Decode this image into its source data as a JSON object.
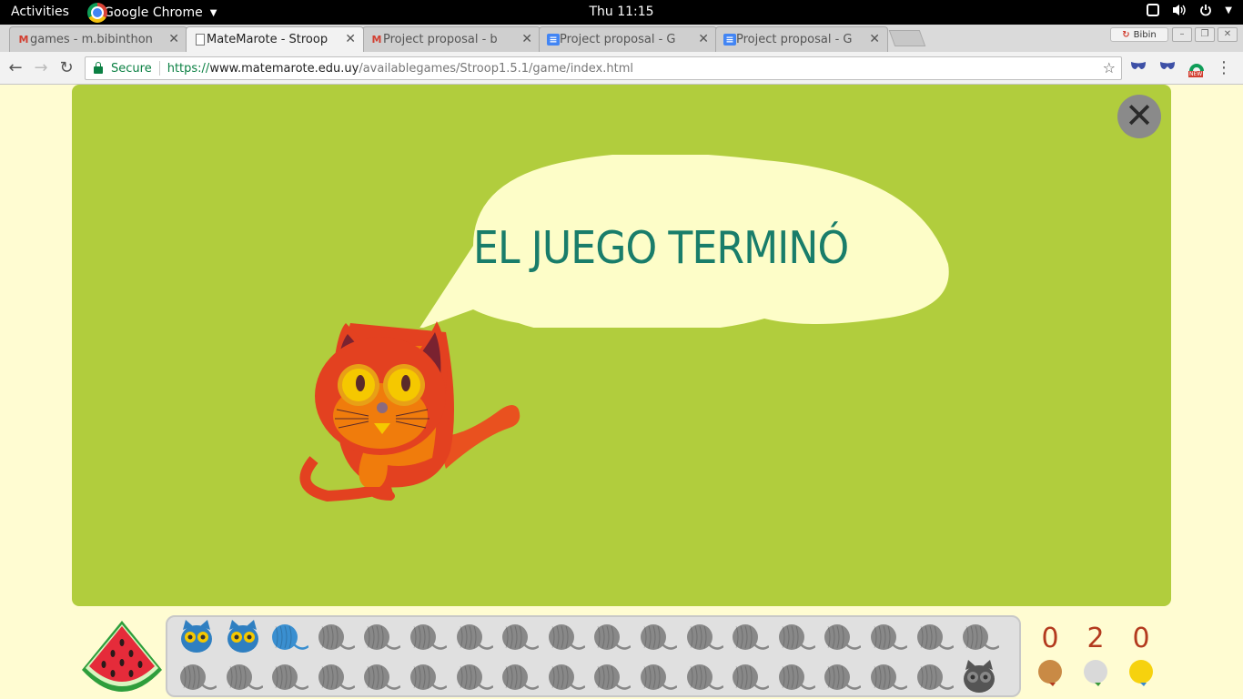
{
  "system_bar": {
    "activities": "Activities",
    "app_name": "Google Chrome",
    "clock": "Thu 11:15",
    "icons": [
      "window-icon",
      "volume-icon",
      "power-icon"
    ]
  },
  "browser": {
    "tabs": [
      {
        "title": "games - m.bibinthon",
        "favicon": "gmail-icon",
        "active": false
      },
      {
        "title": "MateMarote - Stroop",
        "favicon": "page-icon",
        "active": true
      },
      {
        "title": "Project proposal - b",
        "favicon": "gmail-icon",
        "active": false
      },
      {
        "title": "Project proposal - G",
        "favicon": "docs-icon",
        "active": false
      },
      {
        "title": "Project proposal - G",
        "favicon": "docs-icon",
        "active": false
      }
    ],
    "profile_name": "Bibin",
    "secure_label": "Secure",
    "url": {
      "scheme": "https://",
      "host": "www.matemarote.edu.uy",
      "path": "/availablegames/Stroop1.5.1/game/index.html"
    },
    "extension_badge": "NEW"
  },
  "game": {
    "message": "EL JUEGO TERMINÓ",
    "colors": {
      "stage": "#b1cd3d",
      "bubble": "#fdfdc8",
      "message": "#197d6a",
      "cat": "#e9511f"
    },
    "progress": {
      "row1": [
        "cat-face-blue",
        "cat-face-blue",
        "yarn-blue",
        "yarn-gray",
        "yarn-gray",
        "yarn-gray",
        "yarn-gray",
        "yarn-gray",
        "yarn-gray",
        "yarn-gray",
        "yarn-gray",
        "yarn-gray",
        "yarn-gray",
        "yarn-gray",
        "yarn-gray",
        "yarn-gray",
        "yarn-gray",
        "yarn-gray"
      ],
      "row2": [
        "yarn-gray",
        "yarn-gray",
        "yarn-gray",
        "yarn-gray",
        "yarn-gray",
        "yarn-gray",
        "yarn-gray",
        "yarn-gray",
        "yarn-gray",
        "yarn-gray",
        "yarn-gray",
        "yarn-gray",
        "yarn-gray",
        "yarn-gray",
        "yarn-gray",
        "yarn-gray",
        "yarn-gray",
        "cat-face-dark"
      ]
    },
    "scores": [
      {
        "value": "0",
        "medal": "bronze-medal-icon",
        "color": "#c98a45"
      },
      {
        "value": "2",
        "medal": "silver-medal-icon",
        "color": "#d9d9d9"
      },
      {
        "value": "0",
        "medal": "gold-medal-icon",
        "color": "#f6d20e"
      }
    ]
  }
}
